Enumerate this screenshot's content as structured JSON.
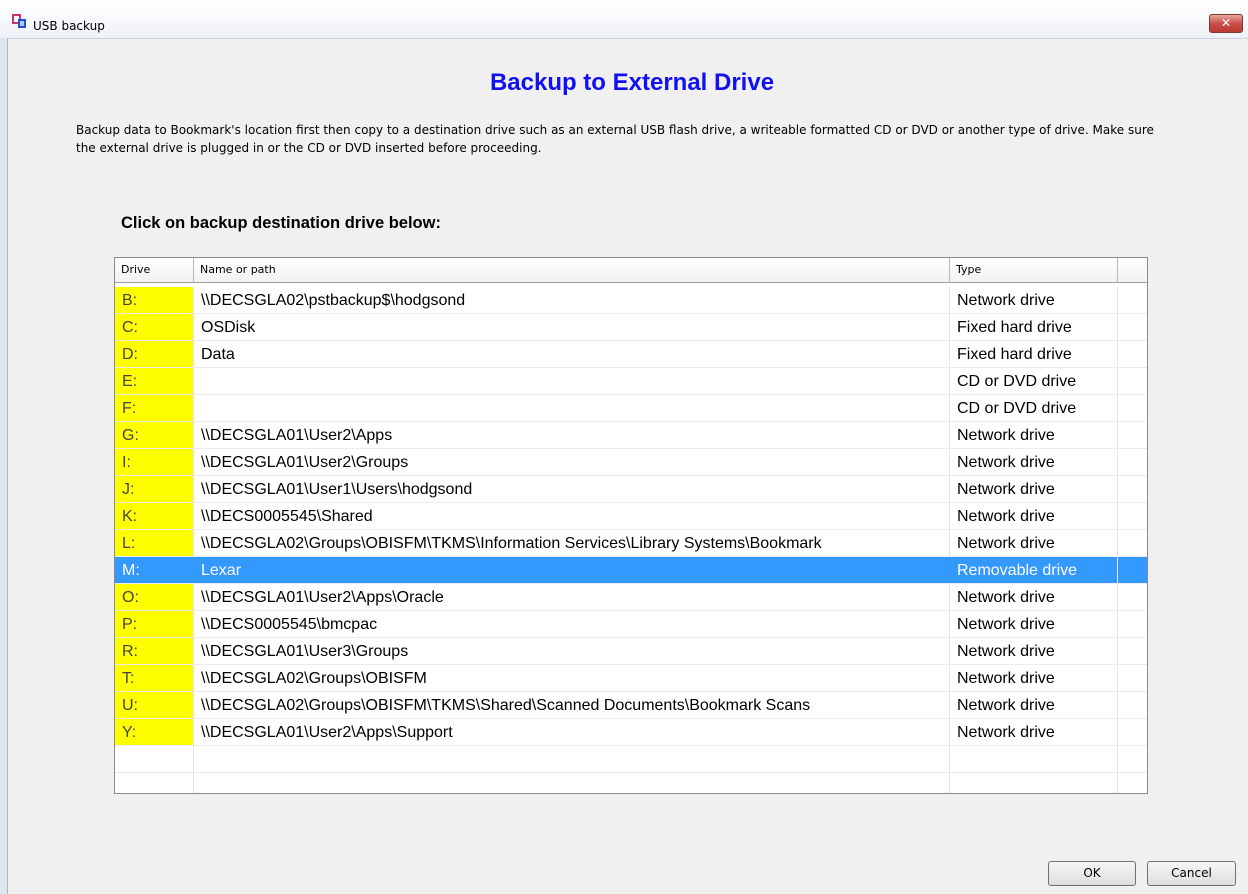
{
  "window": {
    "title": "USB backup",
    "close_glyph": "✕",
    "icon": "usb-backup-app-icon"
  },
  "heading": "Backup to External Drive",
  "description": "Backup data to Bookmark's location first then copy to a destination drive such as an external USB flash drive, a writeable formatted CD or DVD or another type of drive.  Make sure the external drive is plugged in or the CD or DVD inserted before proceeding.",
  "instruction": "Click on backup destination drive below:",
  "table": {
    "columns": [
      "Drive",
      "Name or path",
      "Type"
    ],
    "rows": [
      {
        "drive": "B:",
        "path": "\\\\DECSGLA02\\pstbackup$\\hodgsond",
        "type": "Network drive"
      },
      {
        "drive": "C:",
        "path": "OSDisk",
        "type": "Fixed hard drive"
      },
      {
        "drive": "D:",
        "path": "Data",
        "type": "Fixed hard drive"
      },
      {
        "drive": "E:",
        "path": "",
        "type": "CD or DVD drive"
      },
      {
        "drive": "F:",
        "path": "",
        "type": "CD or DVD drive"
      },
      {
        "drive": "G:",
        "path": "\\\\DECSGLA01\\User2\\Apps",
        "type": "Network drive"
      },
      {
        "drive": "I:",
        "path": "\\\\DECSGLA01\\User2\\Groups",
        "type": "Network drive"
      },
      {
        "drive": "J:",
        "path": "\\\\DECSGLA01\\User1\\Users\\hodgsond",
        "type": "Network drive"
      },
      {
        "drive": "K:",
        "path": "\\\\DECS0005545\\Shared",
        "type": "Network drive"
      },
      {
        "drive": "L:",
        "path": "\\\\DECSGLA02\\Groups\\OBISFM\\TKMS\\Information Services\\Library Systems\\Bookmark",
        "type": "Network drive"
      },
      {
        "drive": "M:",
        "path": "Lexar",
        "type": "Removable drive",
        "selected": true
      },
      {
        "drive": "O:",
        "path": "\\\\DECSGLA01\\User2\\Apps\\Oracle",
        "type": "Network drive"
      },
      {
        "drive": "P:",
        "path": "\\\\DECS0005545\\bmcpac",
        "type": "Network drive"
      },
      {
        "drive": "R:",
        "path": "\\\\DECSGLA01\\User3\\Groups",
        "type": "Network drive"
      },
      {
        "drive": "T:",
        "path": "\\\\DECSGLA02\\Groups\\OBISFM",
        "type": "Network drive"
      },
      {
        "drive": "U:",
        "path": "\\\\DECSGLA02\\Groups\\OBISFM\\TKMS\\Shared\\Scanned Documents\\Bookmark Scans",
        "type": "Network drive"
      },
      {
        "drive": "Y:",
        "path": "\\\\DECSGLA01\\User2\\Apps\\Support",
        "type": "Network drive"
      }
    ]
  },
  "buttons": {
    "ok": "OK",
    "cancel": "Cancel"
  },
  "colors": {
    "heading": "#1010f0",
    "drive_highlight": "#ffff00",
    "selection": "#3399ff"
  }
}
